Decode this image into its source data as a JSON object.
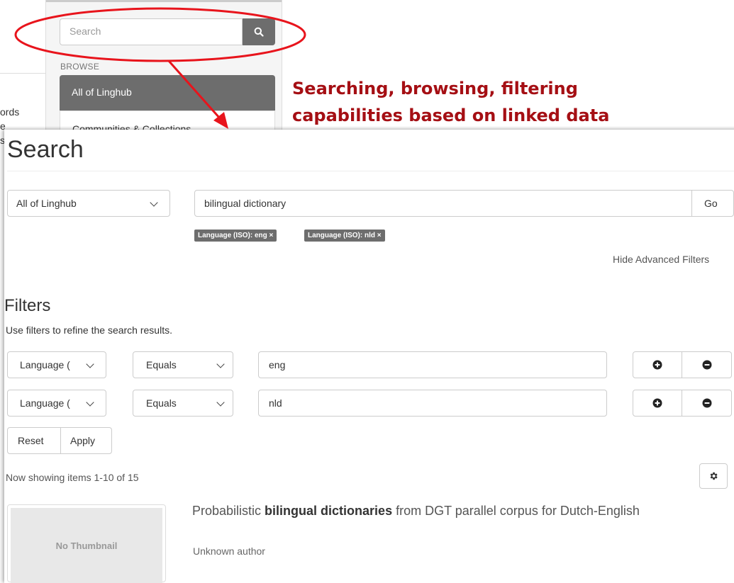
{
  "background_panel": {
    "left_fragments": [
      "ords",
      "e",
      "s"
    ],
    "search_placeholder": "Search",
    "browse_heading": "BROWSE",
    "nav_items": [
      {
        "label": "All of Linghub",
        "active": true
      },
      {
        "label": "Communities & Collections",
        "active": false
      }
    ]
  },
  "annotation": {
    "line1": "Searching, browsing, filtering",
    "line2": "capabilities based on linked data",
    "color": "#a50f14"
  },
  "search_page": {
    "title": "Search",
    "scope_selected": "All of Linghub",
    "query": "bilingual dictionary",
    "go_label": "Go",
    "active_filters": [
      "Language (ISO): eng ×",
      "Language (ISO): nld ×"
    ],
    "hide_advanced_label": "Hide Advanced Filters",
    "filters_heading": "Filters",
    "filters_description": "Use filters to refine the search results.",
    "filter_rows": [
      {
        "field": "Language (",
        "operator": "Equals",
        "value": "eng"
      },
      {
        "field": "Language (",
        "operator": "Equals",
        "value": "nld"
      }
    ],
    "reset_label": "Reset",
    "apply_label": "Apply",
    "showing_text": "Now showing items 1-10 of 15",
    "results": [
      {
        "thumbnail_text": "No Thumbnail",
        "title_before": "Probabilistic ",
        "title_highlight": "bilingual dictionaries",
        "title_after": " from DGT parallel corpus for Dutch-English",
        "author": "Unknown author"
      }
    ]
  },
  "icons": {
    "search_button": "search-icon",
    "add_filter": "plus-circle-icon",
    "remove_filter": "minus-circle-icon",
    "settings": "gear-icon"
  }
}
